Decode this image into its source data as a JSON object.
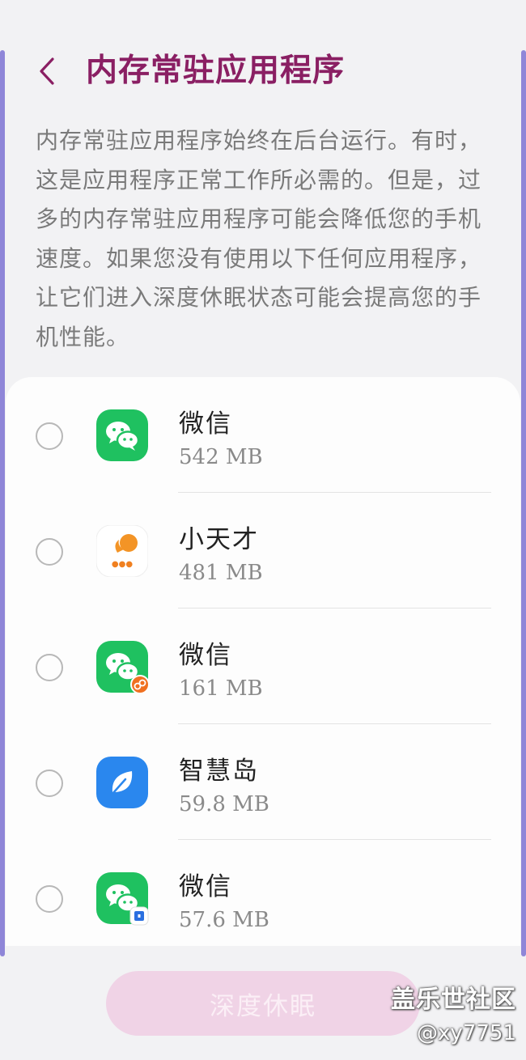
{
  "header": {
    "title": "内存常驻应用程序"
  },
  "description": "内存常驻应用程序始终在后台运行。有时，这是应用程序正常工作所必需的。但是，过多的内存常驻应用程序可能会降低您的手机速度。如果您没有使用以下任何应用程序，让它们进入深度休眠状态可能会提高您的手机性能。",
  "apps": [
    {
      "name": "微信",
      "size": "542 MB",
      "icon": "wechat-icon",
      "selected": false
    },
    {
      "name": "小天才",
      "size": "481 MB",
      "icon": "xiaotiancai-icon",
      "selected": false
    },
    {
      "name": "微信",
      "size": "161 MB",
      "icon": "wechat-clone-icon",
      "selected": false
    },
    {
      "name": "智慧岛",
      "size": "59.8 MB",
      "icon": "leaf-icon",
      "selected": false
    },
    {
      "name": "微信",
      "size": "57.6 MB",
      "icon": "wechat-secure-folder-icon",
      "selected": false
    }
  ],
  "actions": {
    "deep_sleep_label": "深度休眠"
  },
  "watermark": {
    "brand": "盖乐世社区",
    "handle": "@xy7751"
  },
  "colors": {
    "accent": "#8a1f63",
    "wechat_green": "#1fc160",
    "button_bg": "#f0d3e6",
    "edge_bar": "#8f86d8"
  }
}
